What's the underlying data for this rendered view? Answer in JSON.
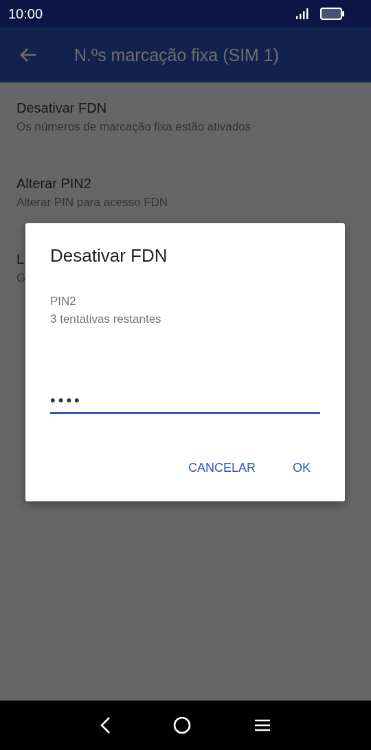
{
  "status_bar": {
    "time": "10:00"
  },
  "app_bar": {
    "title": "N.ºs marcação fixa (SIM 1)"
  },
  "settings": [
    {
      "title": "Desativar FDN",
      "subtitle": "Os números de marcação fixa estão ativados"
    },
    {
      "title": "Alterar PIN2",
      "subtitle": "Alterar PIN para acesso FDN"
    },
    {
      "title": "L",
      "subtitle": "G"
    }
  ],
  "dialog": {
    "title": "Desativar FDN",
    "label": "PIN2",
    "hint": "3 tentativas restantes",
    "value": "••••",
    "buttons": [
      "CANCELAR",
      "OK"
    ]
  }
}
